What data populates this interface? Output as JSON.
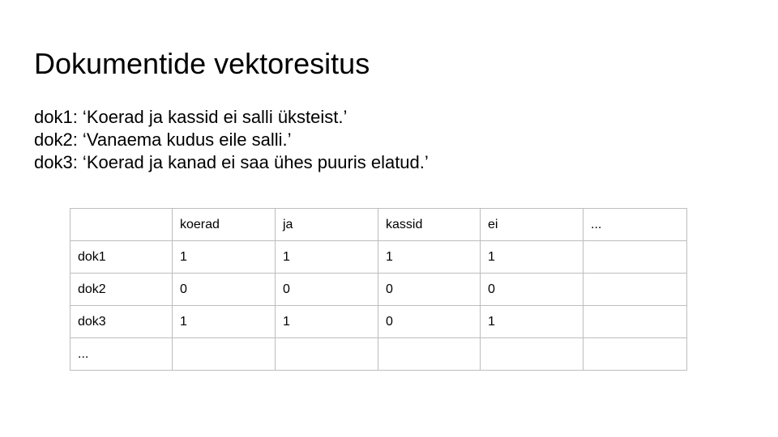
{
  "slide": {
    "title": "Dokumentide vektoresitus",
    "documents": [
      "dok1: ‘Koerad ja kassid ei salli üksteist.’",
      "dok2: ‘Vanaema kudus eile salli.’",
      "dok3: ‘Koerad ja kanad ei saa ühes puuris elatud.’"
    ]
  },
  "table": {
    "header": [
      "",
      "koerad",
      "ja",
      "kassid",
      "ei",
      "..."
    ],
    "rows": [
      [
        "dok1",
        "1",
        "1",
        "1",
        "1",
        ""
      ],
      [
        "dok2",
        "0",
        "0",
        "0",
        "0",
        ""
      ],
      [
        "dok3",
        "1",
        "1",
        "0",
        "1",
        ""
      ],
      [
        "...",
        "",
        "",
        "",
        "",
        ""
      ]
    ]
  }
}
